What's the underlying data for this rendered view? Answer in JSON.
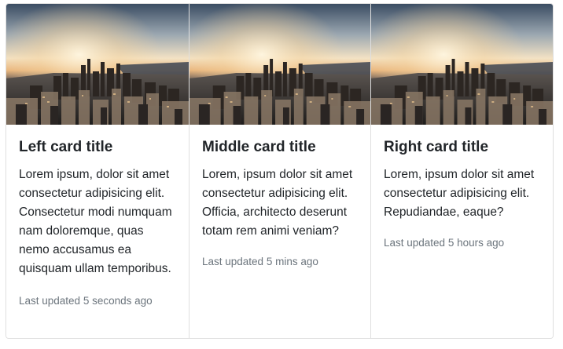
{
  "cards": [
    {
      "image_alt": "city skyline at sunset",
      "title": "Left card title",
      "text": "Lorem ipsum, dolor sit amet consectetur adipisicing elit. Consectetur modi numquam nam doloremque, quas nemo accusamus ea quisquam ullam temporibus.",
      "updated": "Last updated 5 seconds ago"
    },
    {
      "image_alt": "city skyline at sunset",
      "title": "Middle card title",
      "text": "Lorem, ipsum dolor sit amet consectetur adipisicing elit. Officia, architecto deserunt totam rem animi veniam?",
      "updated": "Last updated 5 mins ago"
    },
    {
      "image_alt": "city skyline at sunset",
      "title": "Right card title",
      "text": "Lorem, ipsum dolor sit amet consectetur adipisicing elit. Repudiandae, eaque?",
      "updated": "Last updated 5 hours ago"
    }
  ]
}
